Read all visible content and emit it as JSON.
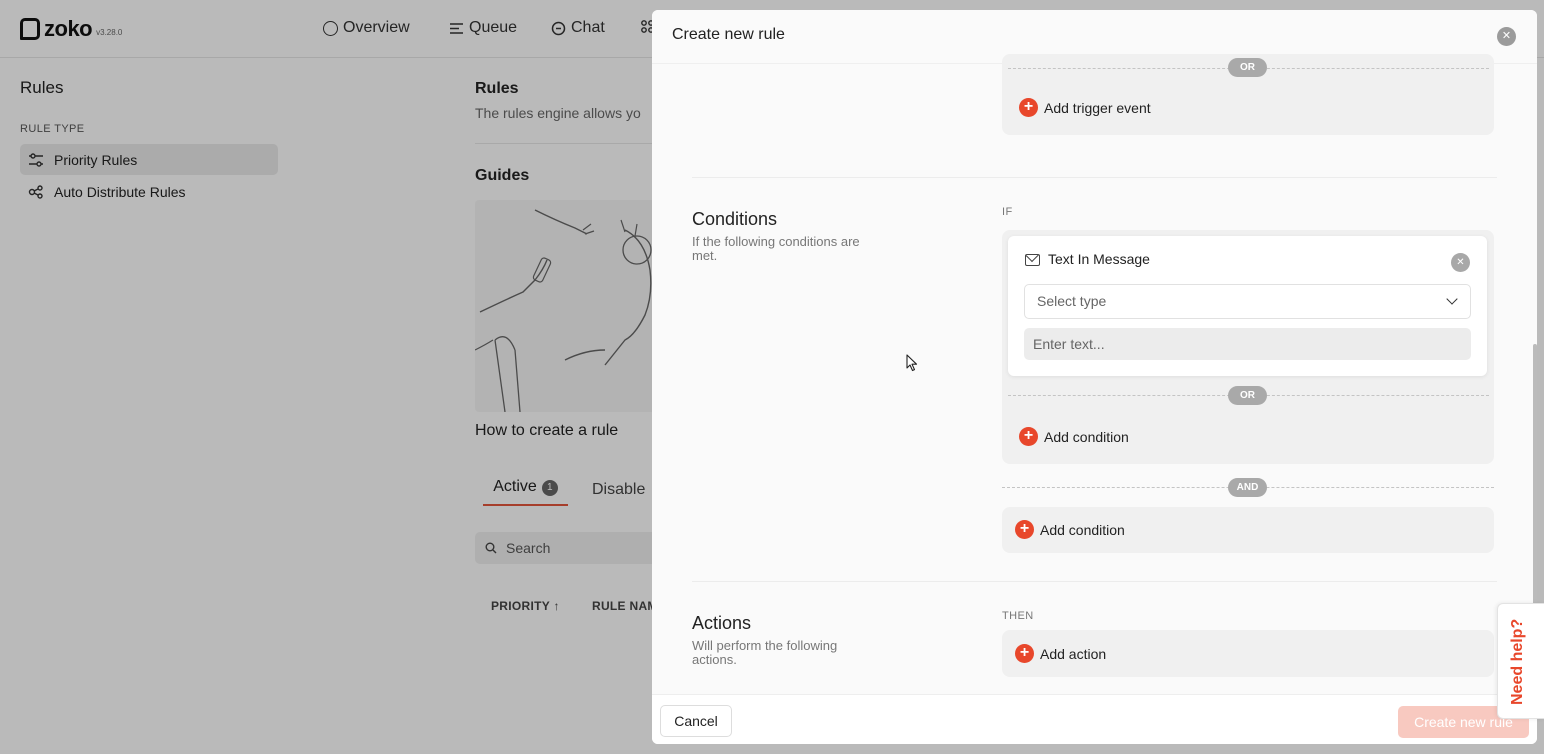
{
  "app": {
    "logo": "zoko",
    "version": "v3.28.0",
    "nav": [
      {
        "label": "Overview",
        "icon": "circle-icon"
      },
      {
        "label": "Queue",
        "icon": "queue-icon"
      },
      {
        "label": "Chat",
        "icon": "chat-icon"
      }
    ],
    "more_icon": "grid-icon"
  },
  "sidebar": {
    "title": "Rules",
    "section_label": "RULE TYPE",
    "items": [
      {
        "label": "Priority Rules",
        "icon": "sliders-icon",
        "active": true
      },
      {
        "label": "Auto Distribute Rules",
        "icon": "share-icon",
        "active": false
      }
    ]
  },
  "main": {
    "title": "Rules",
    "description": "The rules engine allows yo",
    "guides_title": "Guides",
    "guide_caption": "How to create a rule",
    "tabs": [
      {
        "label": "Active",
        "count": "1"
      },
      {
        "label": "Disable"
      }
    ],
    "search_placeholder": "Search",
    "columns": [
      "PRIORITY ↑",
      "RULE NAM"
    ]
  },
  "modal": {
    "title": "Create new rule",
    "trigger": {
      "or_label": "OR",
      "add_label": "Add trigger event"
    },
    "conditions": {
      "title": "Conditions",
      "description": "If the following conditions are met.",
      "keyword": "IF",
      "card": {
        "title": "Text In Message",
        "select_placeholder": "Select type",
        "text_placeholder": "Enter text..."
      },
      "or_label": "OR",
      "add_inner_label": "Add condition",
      "and_label": "AND",
      "add_outer_label": "Add condition"
    },
    "actions": {
      "title": "Actions",
      "description": "Will perform the following actions.",
      "keyword": "THEN",
      "add_label": "Add action"
    },
    "footer": {
      "cancel": "Cancel",
      "create": "Create new rule"
    }
  },
  "help": {
    "label": "Need help?"
  },
  "colors": {
    "accent": "#e8472b",
    "overlay": "rgba(0,0,0,0.26)"
  }
}
